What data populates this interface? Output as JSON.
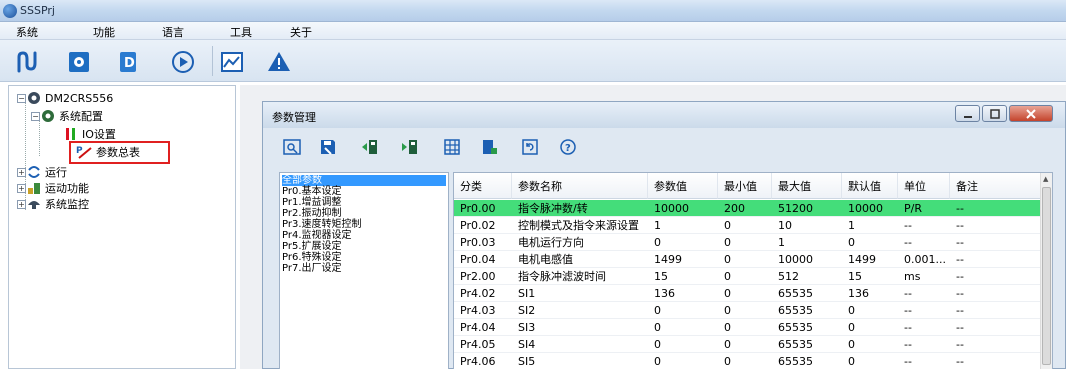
{
  "window": {
    "title": "SSSPrj"
  },
  "menu": [
    "系统",
    "功能",
    "语言",
    "工具",
    "关于"
  ],
  "toolbar_icons": [
    "wave-icon",
    "settings-box-icon",
    "document-d-icon",
    "play-icon",
    "chart-icon",
    "warning-icon"
  ],
  "tree": {
    "root": "DM2CRS556",
    "system_config": "系统配置",
    "io_settings": "IO设置",
    "param_summary": "参数总表",
    "run": "运行",
    "motion": "运动功能",
    "monitor": "系统监控"
  },
  "param_window": {
    "title": "参数管理",
    "toolbar_icons": [
      "open-icon",
      "save-icon",
      "upload-icon",
      "download-icon",
      "grid-icon",
      "export-icon",
      "reset-icon",
      "help-icon"
    ],
    "categories": [
      "全部参数",
      "Pr0.基本设定",
      "Pr1.增益调整",
      "Pr2.振动抑制",
      "Pr3.速度转矩控制",
      "Pr4.监视器设定",
      "Pr5.扩展设定",
      "Pr6.特殊设定",
      "Pr7.出厂设定"
    ],
    "columns": [
      "分类",
      "参数名称",
      "参数值",
      "最小值",
      "最大值",
      "默认值",
      "单位",
      "备注"
    ],
    "rows": [
      [
        "Pr0.00",
        "指令脉冲数/转",
        "10000",
        "200",
        "51200",
        "10000",
        "P/R",
        "--"
      ],
      [
        "Pr0.02",
        "控制模式及指令来源设置",
        "1",
        "0",
        "10",
        "1",
        "--",
        "--"
      ],
      [
        "Pr0.03",
        "电机运行方向",
        "0",
        "0",
        "1",
        "0",
        "--",
        "--"
      ],
      [
        "Pr0.04",
        "电机电感值",
        "1499",
        "0",
        "10000",
        "1499",
        "0.001...",
        "--"
      ],
      [
        "Pr2.00",
        "指令脉冲滤波时间",
        "15",
        "0",
        "512",
        "15",
        "ms",
        "--"
      ],
      [
        "Pr4.02",
        "SI1",
        "136",
        "0",
        "65535",
        "136",
        "--",
        "--"
      ],
      [
        "Pr4.03",
        "SI2",
        "0",
        "0",
        "65535",
        "0",
        "--",
        "--"
      ],
      [
        "Pr4.04",
        "SI3",
        "0",
        "0",
        "65535",
        "0",
        "--",
        "--"
      ],
      [
        "Pr4.05",
        "SI4",
        "0",
        "0",
        "65535",
        "0",
        "--",
        "--"
      ],
      [
        "Pr4.06",
        "SI5",
        "0",
        "0",
        "65535",
        "0",
        "--",
        "--"
      ]
    ]
  },
  "colors": {
    "highlight_row": "#44dd7a",
    "selected_item": "#3399ff",
    "annotation_box": "#e02020"
  }
}
